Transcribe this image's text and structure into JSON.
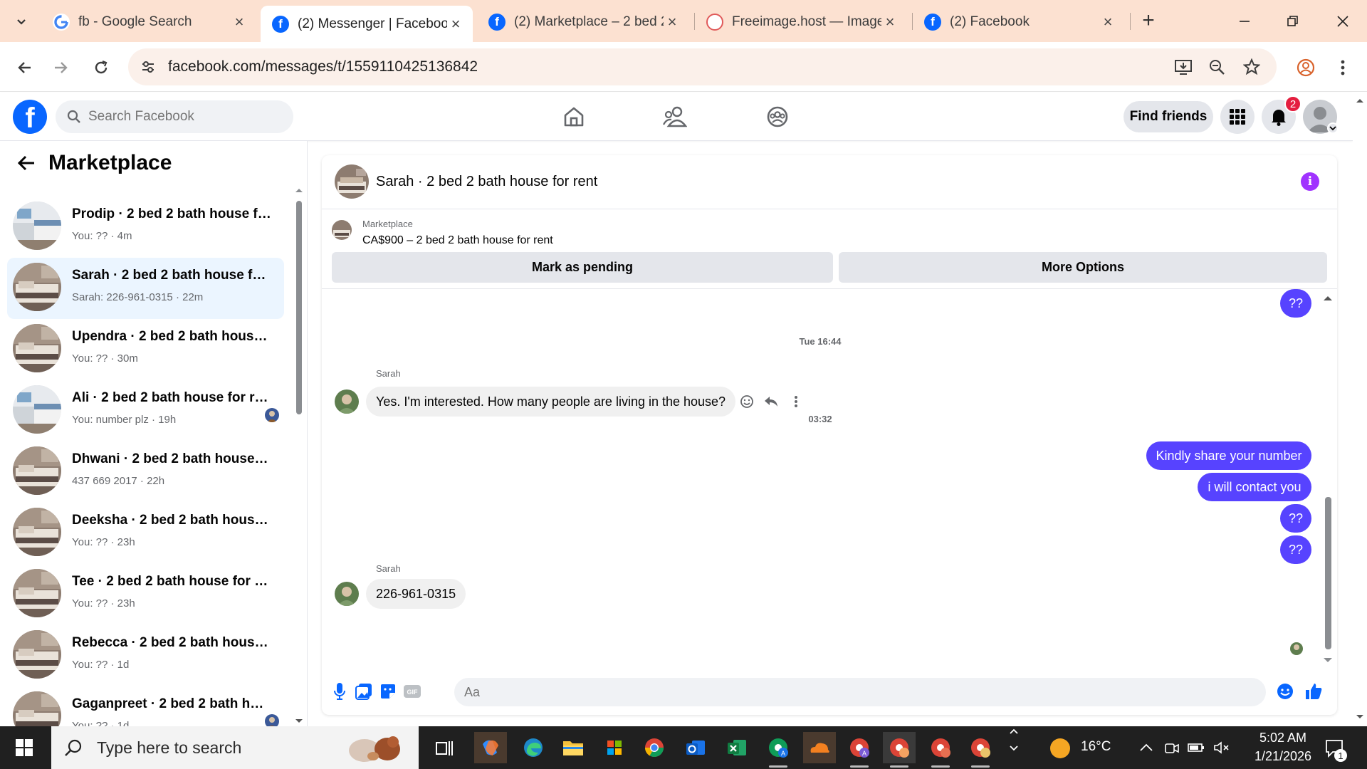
{
  "browser": {
    "tabs": [
      {
        "title": "fb - Google Search",
        "favicon": "google-icon",
        "active": false
      },
      {
        "title": "(2) Messenger | Facebook",
        "favicon": "facebook-icon",
        "active": true
      },
      {
        "title": "(2) Marketplace – 2 bed 2",
        "favicon": "facebook-icon",
        "active": false
      },
      {
        "title": "Freeimage.host — Image",
        "favicon": "freeimage-icon",
        "active": false
      },
      {
        "title": "(2) Facebook",
        "favicon": "facebook-icon",
        "active": false
      }
    ],
    "url": "facebook.com/messages/t/1559110425136842",
    "accent": "#fce1d1"
  },
  "fb_header": {
    "search_placeholder": "Search Facebook",
    "find_friends": "Find friends",
    "notification_count": "2",
    "brand_color": "#0866ff"
  },
  "sidebar": {
    "title": "Marketplace",
    "conversations": [
      {
        "name": "Prodip · 2 bed 2 bath house for rent",
        "sub": "You: ?? · 4m",
        "active": false,
        "thumb": "room-blue"
      },
      {
        "name": "Sarah · 2 bed 2 bath house for rent",
        "sub": "Sarah: 226-961-0315 · 22m",
        "active": true,
        "thumb": "room-bed"
      },
      {
        "name": "Upendra · 2 bed 2 bath house for rent",
        "sub": "You: ?? · 30m",
        "active": false,
        "thumb": "room-bed"
      },
      {
        "name": "Ali · 2 bed 2 bath house for rent",
        "sub": "You: number plz · 19h",
        "active": false,
        "thumb": "room-blue",
        "seen": true
      },
      {
        "name": "Dhwani · 2 bed 2 bath house for rent",
        "sub": "437 669 2017 · 22h",
        "active": false,
        "thumb": "room-bed"
      },
      {
        "name": "Deeksha · 2 bed 2 bath house for rent",
        "sub": "You: ?? · 23h",
        "active": false,
        "thumb": "room-bed"
      },
      {
        "name": "Tee · 2 bed 2 bath house for rent",
        "sub": "You: ?? · 23h",
        "active": false,
        "thumb": "room-bed"
      },
      {
        "name": "Rebecca · 2 bed 2 bath house for rent",
        "sub": "You: ?? · 1d",
        "active": false,
        "thumb": "room-bed"
      },
      {
        "name": "Gaganpreet · 2 bed 2 bath house for rent",
        "sub": "You: ?? · 1d",
        "active": false,
        "thumb": "room-bed",
        "seen": true
      }
    ]
  },
  "chat": {
    "title": "Sarah · 2 bed 2 bath house for rent",
    "marketplace_label": "Marketplace",
    "listing": "CA$900 – 2 bed 2 bath house for rent",
    "mark_pending": "Mark as pending",
    "more_options": "More Options",
    "timestamps": [
      "Tue 16:44",
      "03:32"
    ],
    "sender_name": "Sarah",
    "messages": {
      "out_top": "??",
      "in_1": "Yes. I'm interested. How many people are living in the house?",
      "out_1": "Kindly share your number",
      "out_2": "i will contact you",
      "out_3": "??",
      "out_4": "??",
      "in_2": "226-961-0315"
    },
    "composer_placeholder": "Aa",
    "outgoing_color": "#5743ff",
    "info_color": "#a033ff"
  },
  "taskbar": {
    "search_placeholder": "Type here to search",
    "temperature": "16°C",
    "time": "5:02 AM",
    "date": "1/21/2026",
    "notification_count": "1"
  }
}
